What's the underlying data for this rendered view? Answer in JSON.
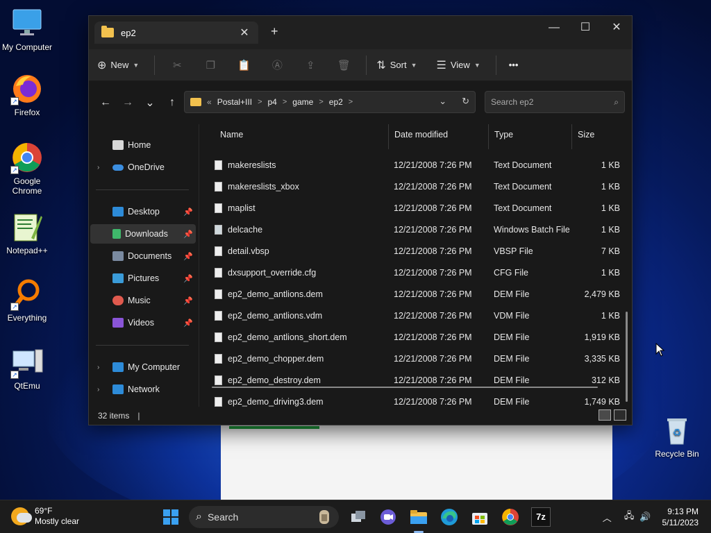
{
  "desktop": {
    "icons": [
      {
        "label": "My Computer",
        "icon": "monitor-icon"
      },
      {
        "label": "Firefox",
        "icon": "firefox-icon"
      },
      {
        "label": "Google Chrome",
        "icon": "chrome-icon"
      },
      {
        "label": "Notepad++",
        "icon": "notepadpp-icon"
      },
      {
        "label": "Everything",
        "icon": "magnifier-icon"
      },
      {
        "label": "QtEmu",
        "icon": "qtemu-icon"
      },
      {
        "label": "Recycle Bin",
        "icon": "recycle-bin-icon"
      }
    ]
  },
  "window": {
    "tab_title": "ep2",
    "tab_close": "✕",
    "new_tab": "+",
    "controls": {
      "minimize": "—",
      "maximize": "☐",
      "close": "✕"
    },
    "toolbar": {
      "new_label": "New",
      "sort_label": "Sort",
      "view_label": "View",
      "more_label": "•••"
    },
    "nav_buttons": {
      "back": "←",
      "forward": "→",
      "recent": "⌄",
      "up": "↑"
    },
    "address": {
      "overflow": "«",
      "crumbs": [
        "Postal+III",
        "p4",
        "game",
        "ep2"
      ],
      "separator": ">"
    },
    "search_placeholder": "Search ep2",
    "sidebar": {
      "items": [
        {
          "label": "Home",
          "icon": "home-icon",
          "color": "#e8e8e8"
        },
        {
          "label": "OneDrive",
          "icon": "onedrive-icon",
          "color": "#3b8ee0"
        },
        {
          "label": "Desktop",
          "icon": "desktop-icon",
          "color": "#2d8bd8",
          "pinned": true
        },
        {
          "label": "Downloads",
          "icon": "download-icon",
          "color": "#3fb86b",
          "pinned": true
        },
        {
          "label": "Documents",
          "icon": "documents-icon",
          "color": "#7a8aa0",
          "pinned": true
        },
        {
          "label": "Pictures",
          "icon": "pictures-icon",
          "color": "#3a9bd8",
          "pinned": true
        },
        {
          "label": "Music",
          "icon": "music-icon",
          "color": "#e05a4e",
          "pinned": true
        },
        {
          "label": "Videos",
          "icon": "videos-icon",
          "color": "#8a55d8",
          "pinned": true
        },
        {
          "label": "My Computer",
          "icon": "computer-icon",
          "color": "#2d8bd8"
        },
        {
          "label": "Network",
          "icon": "network-icon",
          "color": "#2d8bd8"
        }
      ]
    },
    "columns": {
      "name": "Name",
      "date": "Date modified",
      "type": "Type",
      "size": "Size"
    },
    "files": [
      {
        "name": "makereslists",
        "date": "12/21/2008 7:26 PM",
        "type": "Text Document",
        "size": "1 KB"
      },
      {
        "name": "makereslists_xbox",
        "date": "12/21/2008 7:26 PM",
        "type": "Text Document",
        "size": "1 KB"
      },
      {
        "name": "maplist",
        "date": "12/21/2008 7:26 PM",
        "type": "Text Document",
        "size": "1 KB"
      },
      {
        "name": "delcache",
        "date": "12/21/2008 7:26 PM",
        "type": "Windows Batch File",
        "size": "1 KB"
      },
      {
        "name": "detail.vbsp",
        "date": "12/21/2008 7:26 PM",
        "type": "VBSP File",
        "size": "7 KB"
      },
      {
        "name": "dxsupport_override.cfg",
        "date": "12/21/2008 7:26 PM",
        "type": "CFG File",
        "size": "1 KB"
      },
      {
        "name": "ep2_demo_antlions.dem",
        "date": "12/21/2008 7:26 PM",
        "type": "DEM File",
        "size": "2,479 KB"
      },
      {
        "name": "ep2_demo_antlions.vdm",
        "date": "12/21/2008 7:26 PM",
        "type": "VDM File",
        "size": "1 KB"
      },
      {
        "name": "ep2_demo_antlions_short.dem",
        "date": "12/21/2008 7:26 PM",
        "type": "DEM File",
        "size": "1,919 KB"
      },
      {
        "name": "ep2_demo_chopper.dem",
        "date": "12/21/2008 7:26 PM",
        "type": "DEM File",
        "size": "3,335 KB"
      },
      {
        "name": "ep2_demo_destroy.dem",
        "date": "12/21/2008 7:26 PM",
        "type": "DEM File",
        "size": "312 KB"
      },
      {
        "name": "ep2_demo_driving3.dem",
        "date": "12/21/2008 7:26 PM",
        "type": "DEM File",
        "size": "1,749 KB"
      }
    ],
    "status": {
      "items": "32 items",
      "caret": "|"
    }
  },
  "taskbar": {
    "weather": {
      "temp": "69°F",
      "desc": "Mostly clear"
    },
    "search_label": "Search",
    "apps": [
      "start-icon",
      "task-view-icon",
      "chat-icon",
      "file-explorer-icon",
      "edge-icon",
      "store-icon",
      "chrome-icon",
      "7zip-icon"
    ],
    "seven_zip_label": "7z",
    "clock": {
      "time": "9:13 PM",
      "date": "5/11/2023"
    }
  }
}
